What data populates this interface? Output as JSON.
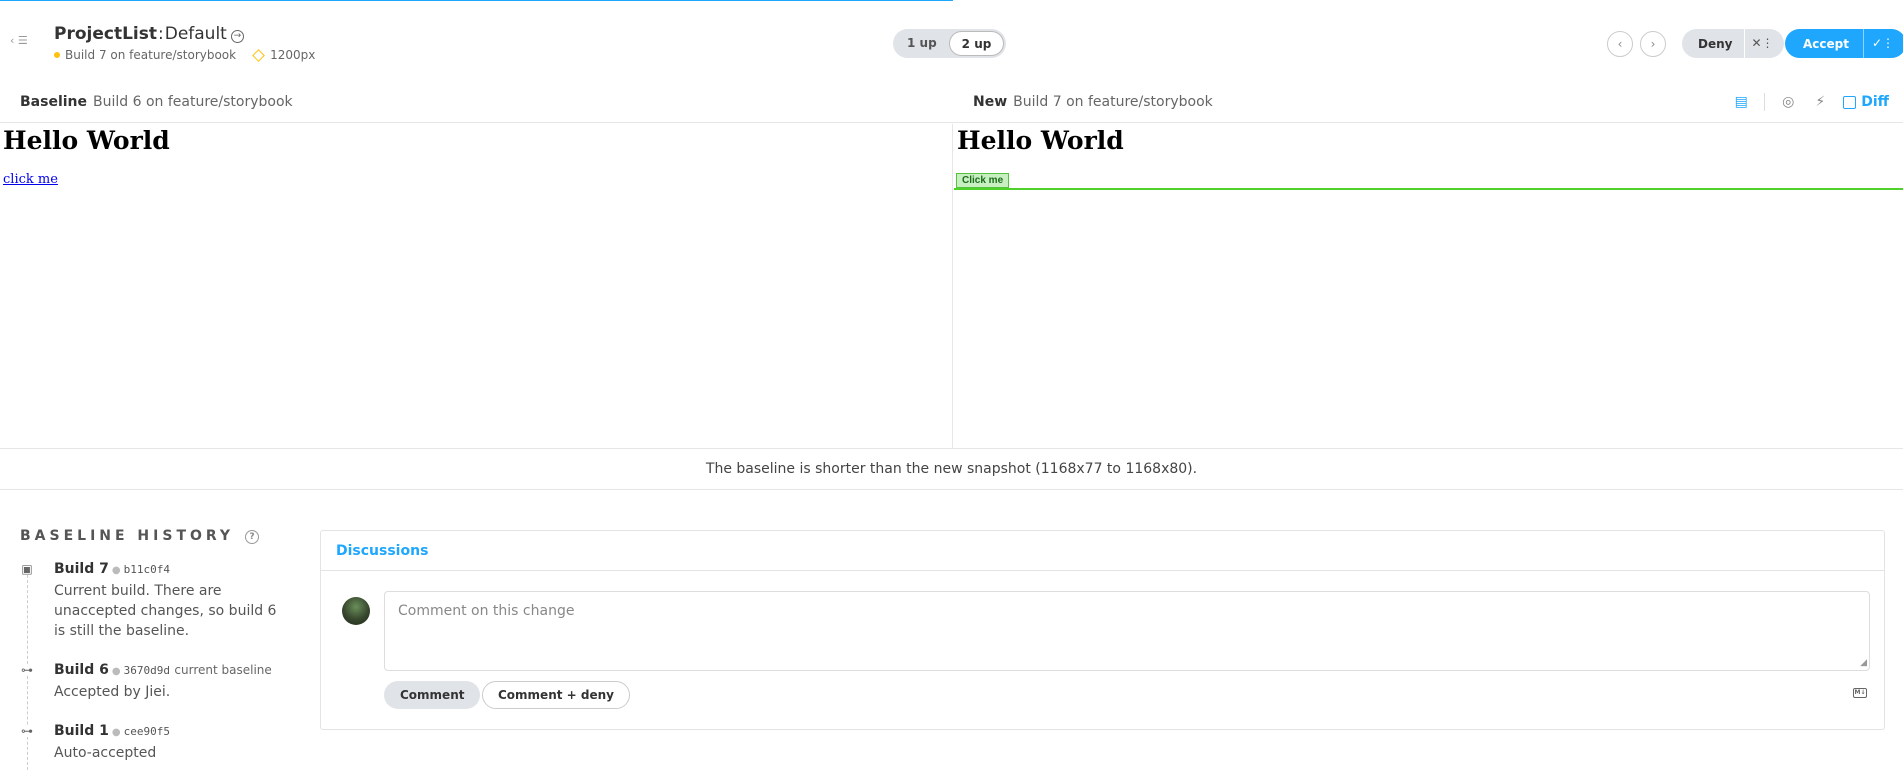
{
  "header": {
    "back_icon": "back-list-icon",
    "component_name": "ProjectList",
    "separator": ":",
    "story_name": "Default",
    "build_text": "Build 7 on feature/storybook",
    "viewport": "1200px",
    "view_toggle": [
      "1 up",
      "2 up"
    ],
    "view_toggle_selected": "2 up",
    "deny_label": "Deny",
    "accept_label": "Accept",
    "accent_color": "#1ea7fd",
    "status_color": "#fdc20d"
  },
  "compare": {
    "baseline_label": "Baseline",
    "baseline_build": "Build 6 on feature/storybook",
    "new_label": "New",
    "new_build": "Build 7 on feature/storybook",
    "diff_label": "Diff"
  },
  "snapshots": {
    "baseline": {
      "heading": "Hello World",
      "link": "click me"
    },
    "new": {
      "heading": "Hello World",
      "button": "Click me"
    },
    "diff_color": "#4fd12b"
  },
  "notice": "The baseline is shorter than the new snapshot (1168x77 to 1168x80).",
  "history": {
    "title": "BASELINE HISTORY",
    "items": [
      {
        "name": "Build 7",
        "hash": "b11c0f4",
        "meta": "",
        "description": "Current build. There are unaccepted changes, so build 6 is still the baseline."
      },
      {
        "name": "Build 6",
        "hash": "3670d9d",
        "meta": "current baseline",
        "description": "Accepted by Jiei."
      },
      {
        "name": "Build 1",
        "hash": "cee90f5",
        "meta": "",
        "description": "Auto-accepted"
      }
    ]
  },
  "discussions": {
    "title": "Discussions",
    "placeholder": "Comment on this change",
    "comment_button": "Comment",
    "comment_deny_button": "Comment + deny",
    "markdown_badge": "M↓"
  }
}
